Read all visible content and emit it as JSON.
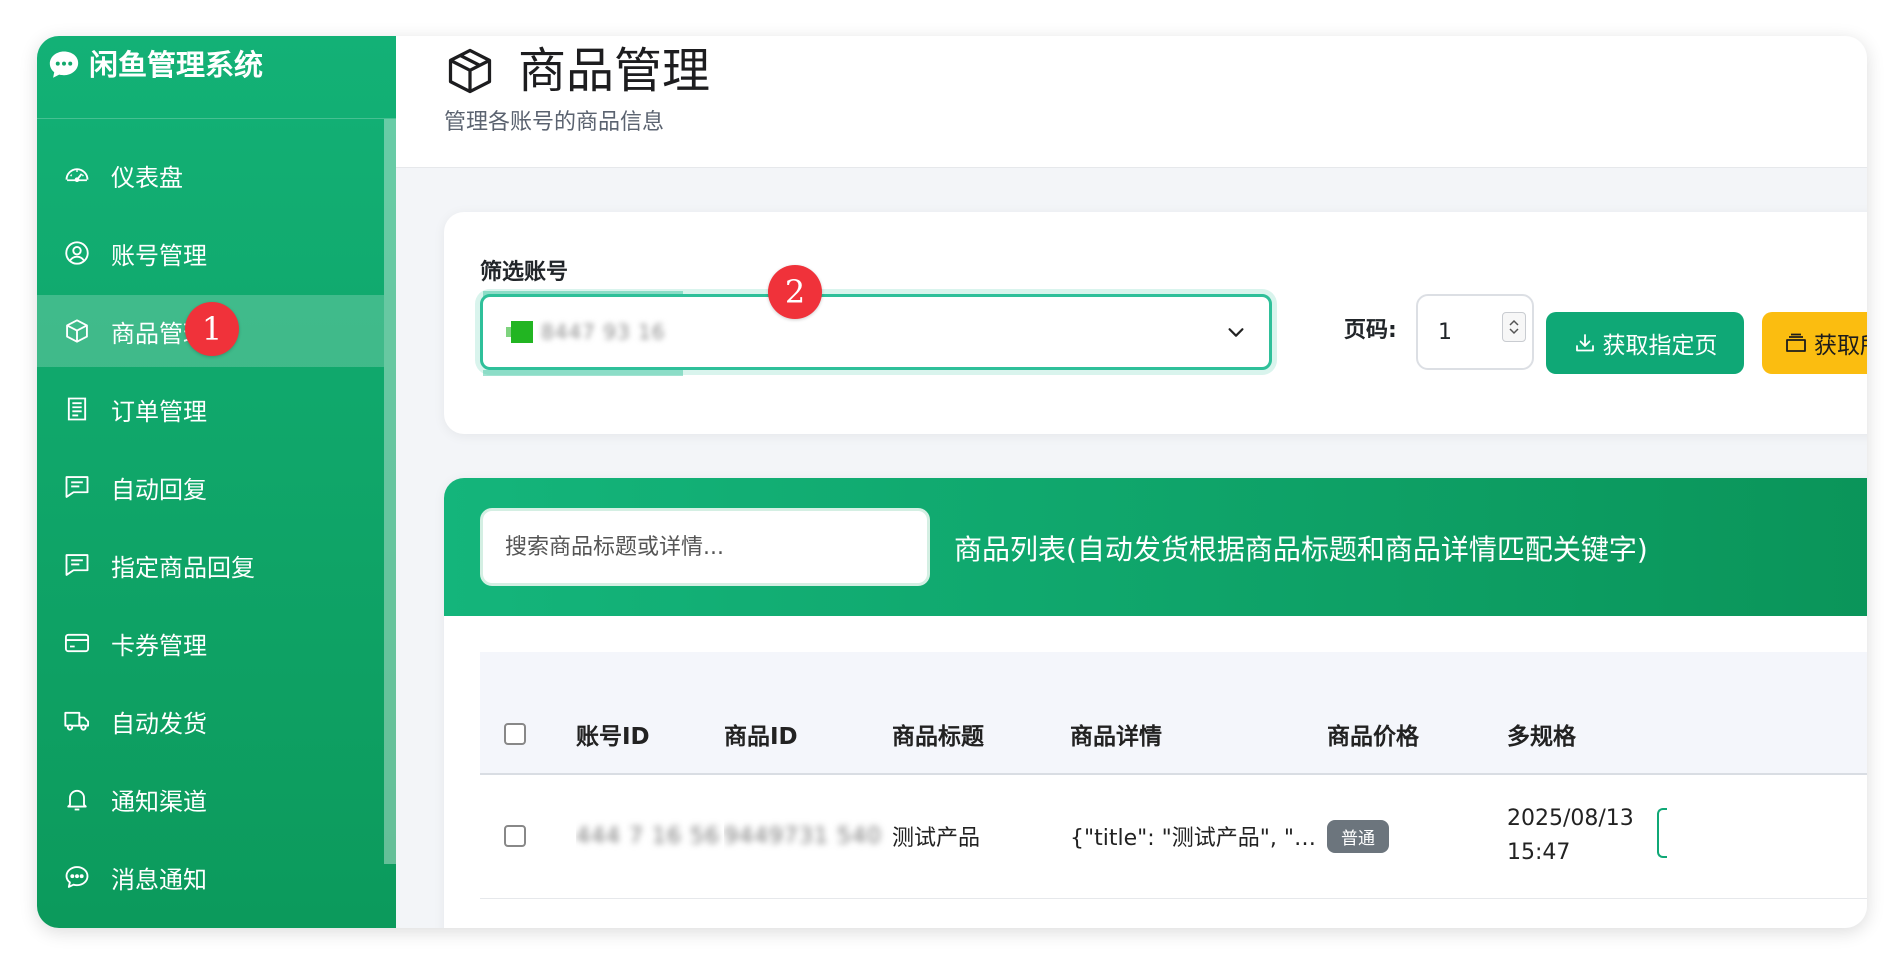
{
  "app": {
    "title": "闲鱼管理系统"
  },
  "sidebar": {
    "items": [
      {
        "label": "仪表盘",
        "icon": "dashboard-icon",
        "active": false
      },
      {
        "label": "账号管理",
        "icon": "user-circle-icon",
        "active": false
      },
      {
        "label": "商品管理",
        "icon": "box-icon",
        "active": true
      },
      {
        "label": "订单管理",
        "icon": "receipt-icon",
        "active": false
      },
      {
        "label": "自动回复",
        "icon": "chat-lines-icon",
        "active": false
      },
      {
        "label": "指定商品回复",
        "icon": "chat-lines-icon",
        "active": false
      },
      {
        "label": "卡券管理",
        "icon": "card-icon",
        "active": false
      },
      {
        "label": "自动发货",
        "icon": "truck-icon",
        "active": false
      },
      {
        "label": "通知渠道",
        "icon": "bell-icon",
        "active": false
      },
      {
        "label": "消息通知",
        "icon": "chat-dots-icon",
        "active": false
      }
    ]
  },
  "page": {
    "title": "商品管理",
    "subtitle": "管理各账号的商品信息"
  },
  "filter": {
    "label": "筛选账号",
    "selected_value": "8447 93 16",
    "page_label": "页码:",
    "page_value": "1",
    "fetch_page_button": "获取指定页",
    "fetch_all_button": "获取所"
  },
  "product_list": {
    "search_placeholder": "搜索商品标题或详情...",
    "title": "商品列表(自动发货根据商品标题和商品详情匹配关键字)",
    "columns": [
      "账号ID",
      "商品ID",
      "商品标题",
      "商品详情",
      "商品价格",
      "多规格"
    ],
    "rows": [
      {
        "account_id": "444 7 16 56",
        "item_id": "9449731 540",
        "title": "测试产品",
        "details": "{\"title\": \"测试产品\", \"pri...",
        "price_badge": "普通",
        "time_line1": "2025/08/13",
        "time_line2": "15:47"
      }
    ]
  },
  "markers": {
    "one": "1",
    "two": "2"
  },
  "colors": {
    "sidebar_green": "#0c9a5c",
    "accent_green": "#0fa876",
    "warning_yellow": "#fbbd10",
    "marker_red": "#f0323a"
  }
}
